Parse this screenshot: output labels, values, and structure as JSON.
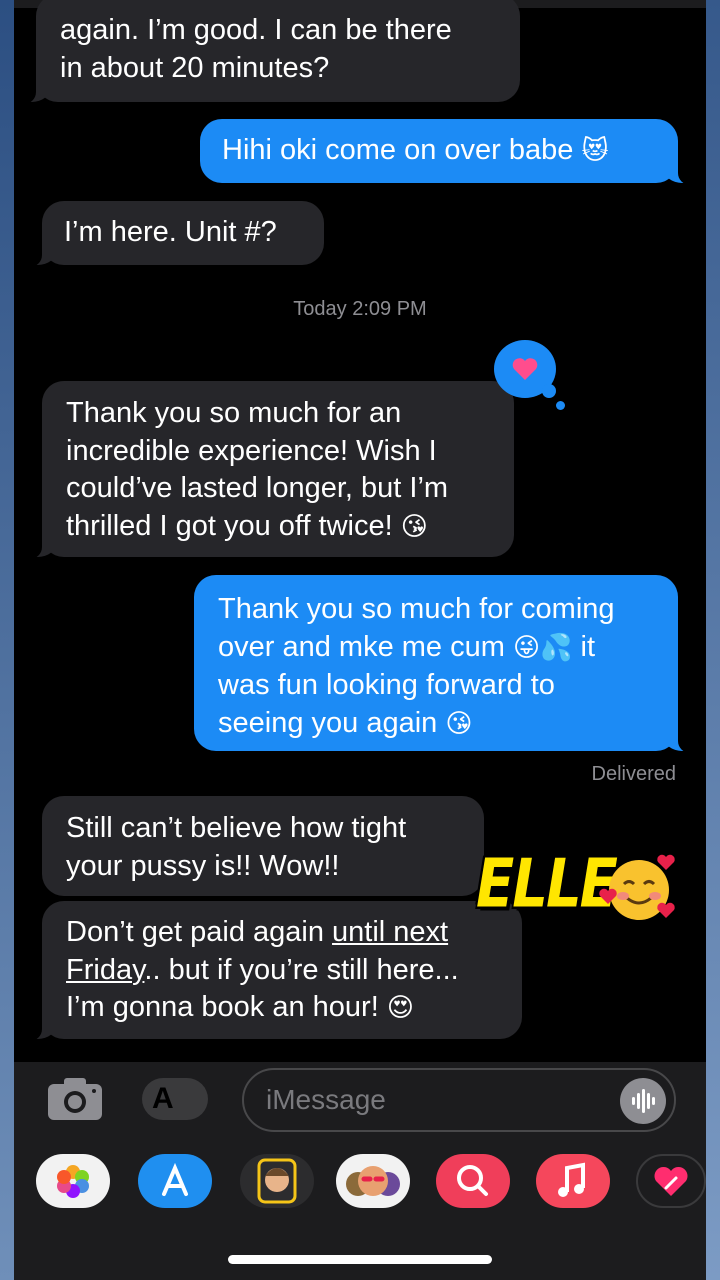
{
  "conversation": {
    "messages": [
      {
        "side": "in",
        "text": "again. I’m good. I can be there\nin about 20 minutes?"
      },
      {
        "side": "out",
        "text": "Hihi oki come on over babe",
        "emoji": "😻"
      },
      {
        "side": "in",
        "text": "I’m here. Unit #?"
      },
      {
        "side": "in",
        "text": "Thank you so much for an\nincredible experience! Wish I\ncould’ve lasted longer, but I’m\nthrilled I got you off twice!",
        "emoji": "😘"
      },
      {
        "side": "out",
        "text_1": "Thank you so much for coming\nover and mke me cum",
        "emoji_1": "😜💦",
        "text_2": " it\nwas fun looking forward to\nseeing you again",
        "emoji_2": "😘"
      },
      {
        "side": "in",
        "text": "Still can’t believe how tight\nyour pussy is!! Wow!!"
      },
      {
        "side": "in",
        "text_1": "Don’t get paid again ",
        "underline_1": "until next",
        "underline_2": "Friday",
        "text_2": ".. but if you’re still here...\nI’m gonna book an hour!",
        "emoji": "😍"
      }
    ],
    "timestamp": "Today 2:09 PM",
    "delivered_label": "Delivered",
    "tapback": "heart"
  },
  "overlay": {
    "sticker_text": "ELLE",
    "sticker_emoji": "🥰"
  },
  "input_bar": {
    "placeholder": "iMessage",
    "icons": [
      "camera-icon",
      "app-store-icon",
      "audio-waveform-icon"
    ]
  },
  "app_tray": {
    "icons": [
      "photos-icon",
      "app-store-icon",
      "memoji-icon",
      "animoji-icon",
      "image-search-icon",
      "music-icon",
      "digital-touch-icon"
    ]
  },
  "colors": {
    "incoming_bubble": "#26262a",
    "outgoing_bubble": "#1c8bf5",
    "background": "#000000"
  }
}
